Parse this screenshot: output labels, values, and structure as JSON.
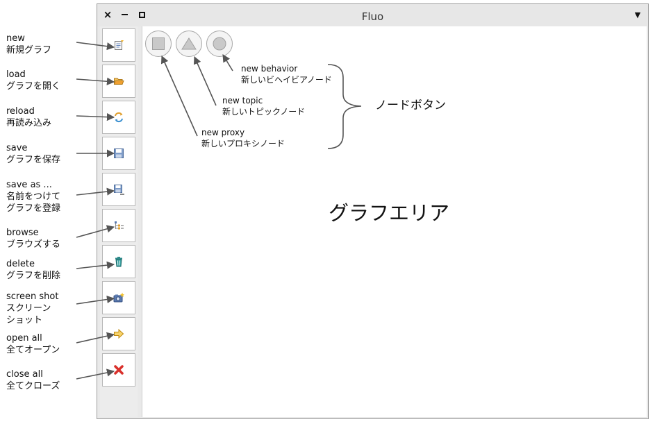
{
  "window": {
    "title": "Fluo",
    "close_glyph": "×",
    "menu_glyph": "▼"
  },
  "toolbar": {
    "items": [
      {
        "icon": "new-graph-icon",
        "label_en": "new",
        "label_ja": "新規グラフ"
      },
      {
        "icon": "open-folder-icon",
        "label_en": "load",
        "label_ja": "グラフを開く"
      },
      {
        "icon": "reload-icon",
        "label_en": "reload",
        "label_ja": "再読み込み"
      },
      {
        "icon": "floppy-save-icon",
        "label_en": "save",
        "label_ja": "グラフを保存"
      },
      {
        "icon": "floppy-save-as-icon",
        "label_en": "save as ...",
        "label_ja_1": "名前をつけて",
        "label_ja_2": "グラフを登録"
      },
      {
        "icon": "tree-browse-icon",
        "label_en": "browse",
        "label_ja": "ブラウズする"
      },
      {
        "icon": "trash-icon",
        "label_en": "delete",
        "label_ja": "グラフを削除"
      },
      {
        "icon": "camera-icon",
        "label_en": "screen shot",
        "label_ja_1": "スクリーン",
        "label_ja_2": "ショット"
      },
      {
        "icon": "arrow-right-icon",
        "label_en": "open all",
        "label_ja": "全てオープン"
      },
      {
        "icon": "red-x-icon",
        "label_en": "close all",
        "label_ja": "全てクローズ"
      }
    ]
  },
  "node_buttons": {
    "group_label": "ノードボタン",
    "proxy": {
      "icon": "square-icon",
      "label_en": "new proxy",
      "label_ja": "新しいプロキシノード"
    },
    "topic": {
      "icon": "triangle-icon",
      "label_en": "new topic",
      "label_ja": "新しいトピックノード"
    },
    "behavior": {
      "icon": "circle-icon",
      "label_en": "new behavior",
      "label_ja": "新しいビヘイビアノード"
    }
  },
  "graph_area": {
    "label": "グラフエリア"
  },
  "colors": {
    "window_bg": "#e9e9e9",
    "node_shape": "#c9c9c9",
    "arrow": "#555555",
    "delete_red": "#d9302b",
    "folder_orange": "#f0a030",
    "trash_teal": "#2e8a8a"
  }
}
